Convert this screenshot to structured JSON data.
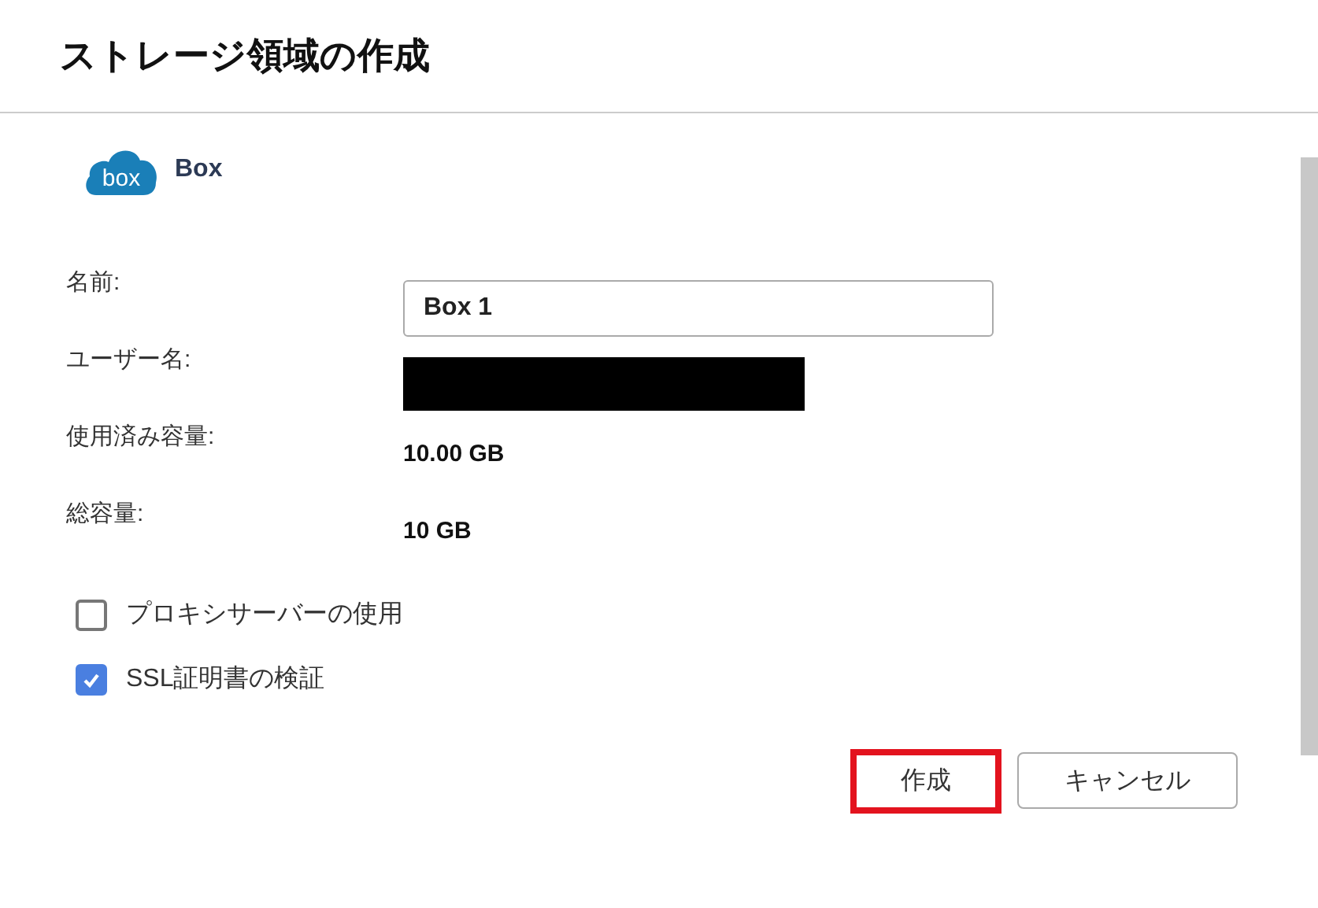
{
  "window": {
    "title": "ストレージ領域の作成"
  },
  "provider": {
    "logo_text": "box",
    "name": "Box"
  },
  "fields": [
    {
      "kind": "input",
      "label": "名前:",
      "value": "Box 1"
    },
    {
      "kind": "redacted",
      "label": "ユーザー名:"
    },
    {
      "kind": "text",
      "label": "使用済み容量:",
      "value": "10.00 GB"
    },
    {
      "kind": "text",
      "label": "総容量:",
      "value": "10 GB"
    }
  ],
  "options": [
    {
      "label": "プロキシサーバーの使用",
      "checked": false
    },
    {
      "label": "SSL証明書の検証",
      "checked": true
    }
  ],
  "buttons": [
    {
      "label": "作成",
      "highlighted": true
    },
    {
      "label": "キャンセル",
      "highlighted": false
    }
  ]
}
